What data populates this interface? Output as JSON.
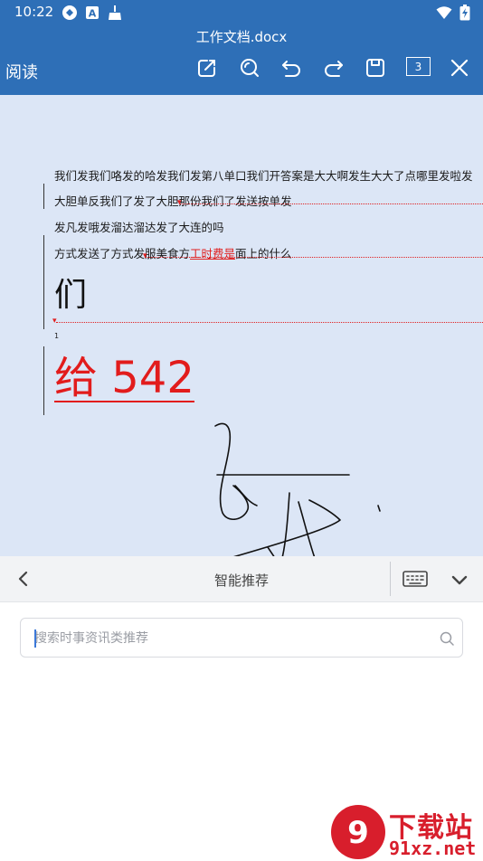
{
  "status_bar": {
    "time": "10:22",
    "icons_left": [
      "sync-icon",
      "text-a-icon",
      "broom-icon"
    ],
    "icons_right": [
      "wifi-icon",
      "battery-charging-icon"
    ]
  },
  "header": {
    "doc_title": "工作文档.docx",
    "mode_label": "阅读",
    "page_count": "3",
    "toolbar_icons": [
      "edit-icon",
      "search-icon",
      "undo-icon",
      "redo-icon",
      "save-icon",
      "page-count-icon",
      "close-icon"
    ]
  },
  "document": {
    "line1": "我们发我们咯发的哈发我们发第八单口我们开答案是大大啊发生大大了点哪里发啦发",
    "line2": "大胆单反我们了发了大胆那份我们了发送按单发",
    "line3": "发凡发哦发溜达溜达发了大连的吗",
    "line4_prefix": "方式发送了方式发服美食方",
    "line4_insert": "工时费是",
    "line4_suffix": "面上的什么",
    "big_char": "们",
    "footnote_mark": "1",
    "big_red_text": "给 542"
  },
  "suggest_bar": {
    "title": "智能推荐"
  },
  "search": {
    "placeholder": "搜索时事资讯类推荐",
    "value": ""
  },
  "watermark": {
    "logo_text": "下载站",
    "site_text": "91xz.net"
  },
  "colors": {
    "primary": "#2e6fb7",
    "doc_bg": "#dce6f6",
    "revision_red": "#e02020",
    "watermark_red": "#d81e2c"
  }
}
